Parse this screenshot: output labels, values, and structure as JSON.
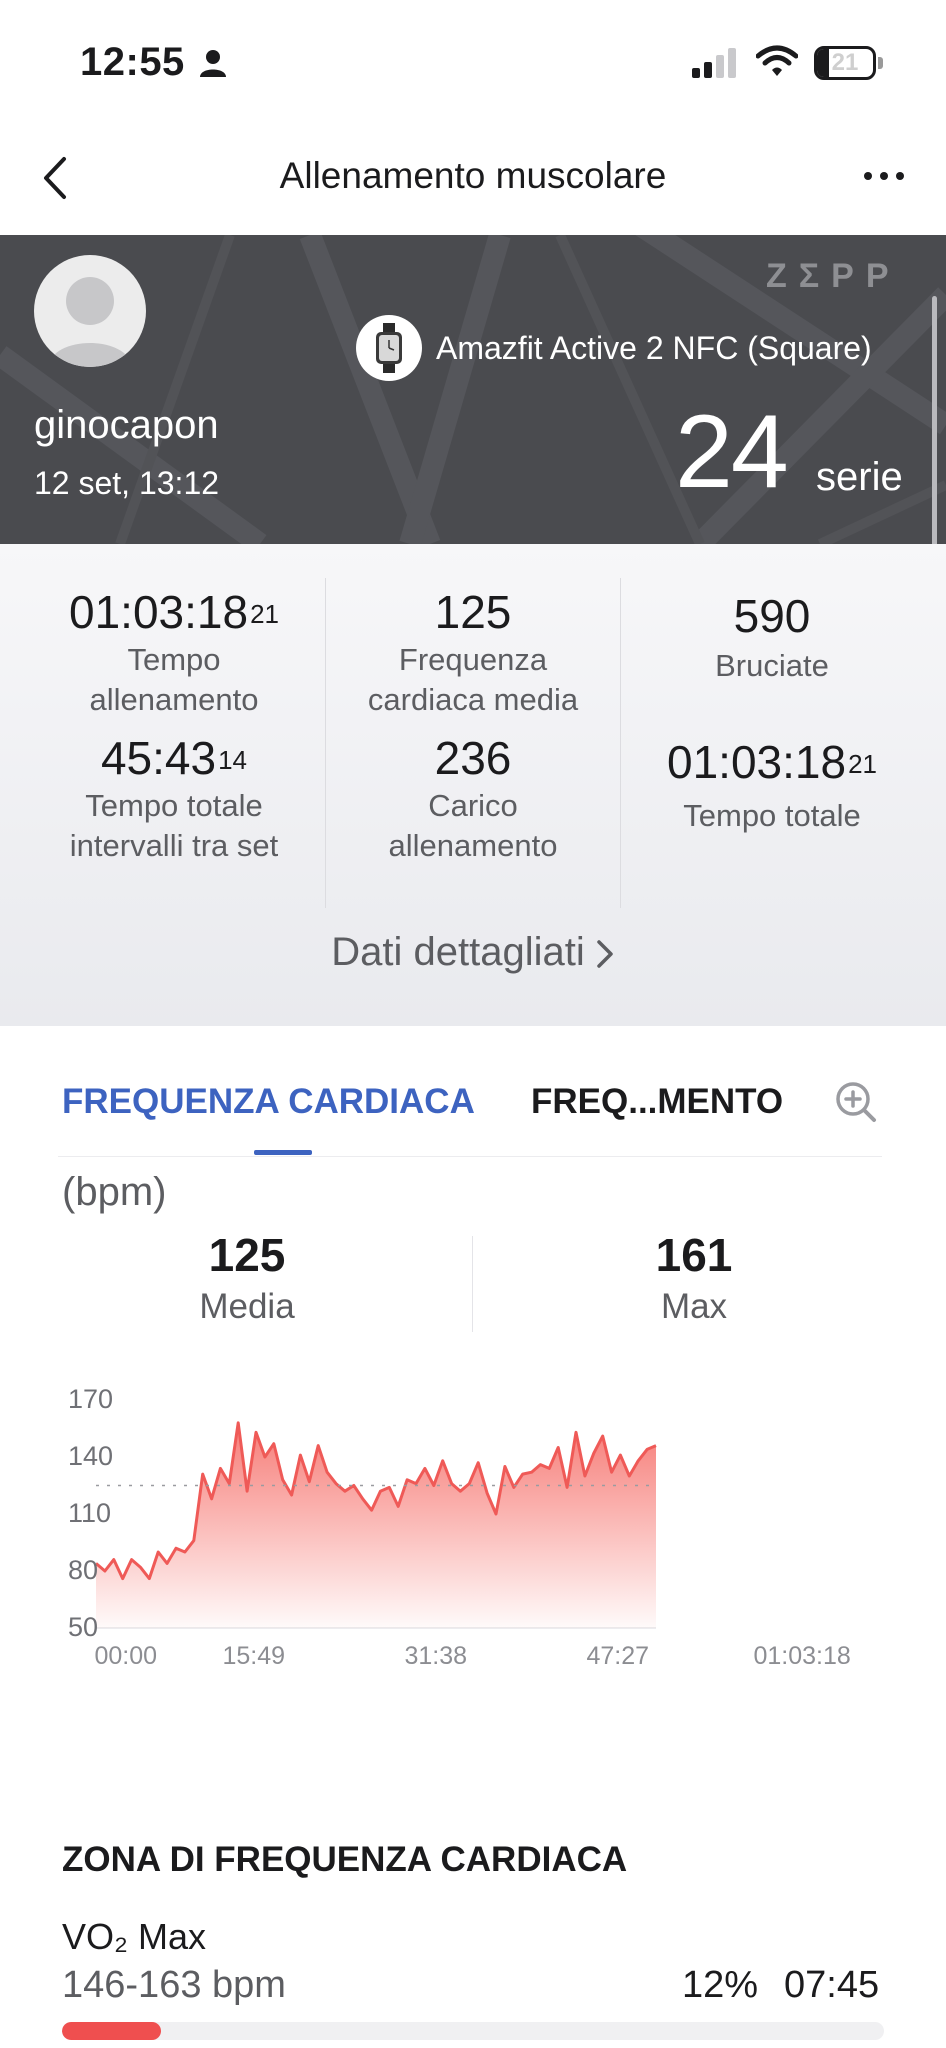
{
  "status_bar": {
    "time": "12:55",
    "battery_level": "21"
  },
  "nav": {
    "title": "Allenamento muscolare"
  },
  "hero": {
    "brand": "ZΣPP",
    "device": "Amazfit Active 2 NFC (Square)",
    "username": "ginocapon",
    "date": "12 set, 13:12",
    "sets_value": "24",
    "sets_label": "serie"
  },
  "stats": [
    {
      "value": "01:03:18",
      "sup": "21",
      "label": "Tempo\nallenamento"
    },
    {
      "value": "125",
      "sup": "",
      "label": "Frequenza\ncardiaca media"
    },
    {
      "value": "590",
      "sup": "",
      "label": "Bruciate"
    },
    {
      "value": "45:43",
      "sup": "14",
      "label": "Tempo totale\nintervalli tra set"
    },
    {
      "value": "236",
      "sup": "",
      "label": "Carico\nallenamento"
    },
    {
      "value": "01:03:18",
      "sup": "21",
      "label": "Tempo totale"
    }
  ],
  "detail_link": "Dati dettagliati",
  "hr_card": {
    "tab_active": "FREQUENZA CARDIACA",
    "tab_inactive": "FREQ...MENTO",
    "unit": "(bpm)",
    "avg_value": "125",
    "avg_label": "Media",
    "max_value": "161",
    "max_label": "Max"
  },
  "chart_data": {
    "type": "area",
    "ylim": [
      50,
      170
    ],
    "yticks": [
      "170",
      "140",
      "110",
      "80",
      "50"
    ],
    "xticks": [
      "00:00",
      "15:49",
      "31:38",
      "47:27",
      "01:03:18"
    ],
    "average_line": 125,
    "line_color": "#ef5a57",
    "x_minutes": [
      0,
      1,
      2,
      3,
      4,
      5,
      6,
      7,
      8,
      9,
      10,
      11,
      12,
      13,
      14,
      15,
      16,
      17,
      18,
      19,
      20,
      21,
      22,
      23,
      24,
      25,
      26,
      27,
      28,
      29,
      30,
      31,
      32,
      33,
      34,
      35,
      36,
      37,
      38,
      39,
      40,
      41,
      42,
      43,
      44,
      45,
      46,
      47,
      48,
      49,
      50,
      51,
      52,
      53,
      54,
      55,
      56,
      57,
      58,
      59,
      60,
      61,
      62,
      63
    ],
    "values": [
      84,
      80,
      86,
      76,
      86,
      82,
      76,
      90,
      84,
      92,
      90,
      96,
      131,
      118,
      134,
      126,
      158,
      122,
      153,
      140,
      147,
      128,
      120,
      141,
      127,
      146,
      132,
      126,
      122,
      125,
      118,
      112,
      122,
      124,
      114,
      128,
      126,
      134,
      125,
      138,
      126,
      122,
      126,
      137,
      121,
      110,
      135,
      124,
      131,
      132,
      136,
      134,
      145,
      124,
      153,
      130,
      142,
      151,
      132,
      141,
      130,
      138,
      144,
      146
    ]
  },
  "zone_card": {
    "title": "ZONA DI FREQUENZA CARDIACA",
    "zone_name": "VO₂ Max",
    "range": "146-163 bpm",
    "percent": "12%",
    "time": "07:45",
    "fill_fraction": 0.12,
    "accent": "#ef4f4f"
  }
}
